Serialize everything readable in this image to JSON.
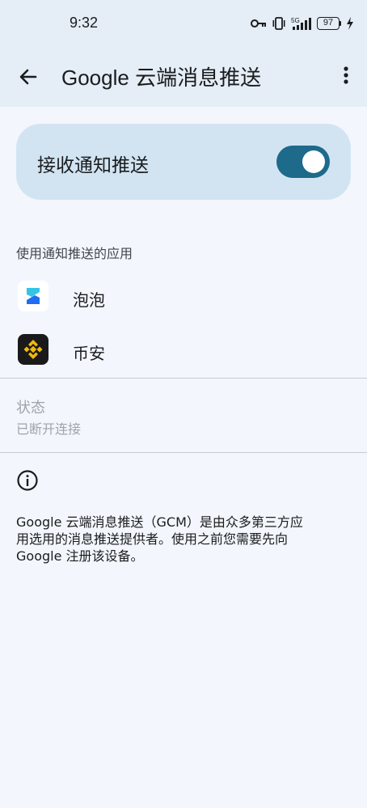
{
  "status_bar": {
    "time": "9:32",
    "network": "5G",
    "battery": "97",
    "icons": [
      "key-icon",
      "vibrate-icon",
      "signal-icon",
      "battery-icon",
      "charging-icon"
    ]
  },
  "app_bar": {
    "title": "Google 云端消息推送",
    "back_icon": "arrow-left",
    "more_icon": "more-vertical"
  },
  "master_switch": {
    "label": "接收通知推送",
    "enabled": true
  },
  "apps_section": {
    "header": "使用通知推送的应用",
    "items": [
      {
        "name": "泡泡",
        "icon": "paopao-app-icon"
      },
      {
        "name": "币安",
        "icon": "binance-app-icon"
      }
    ]
  },
  "connection": {
    "title": "状态",
    "value": "已断开连接"
  },
  "info": {
    "icon": "info-icon",
    "text": "Google 云端消息推送（GCM）是由众多第三方应\n用选用的消息推送提供者。使用之前您需要先向\nGoogle 注册该设备。"
  },
  "colors": {
    "background": "#f3f7fd",
    "header": "#e5edf6",
    "card": "#d2e4f2",
    "toggle_track": "#1d6a8a",
    "binance_yellow": "#f0b90b"
  }
}
